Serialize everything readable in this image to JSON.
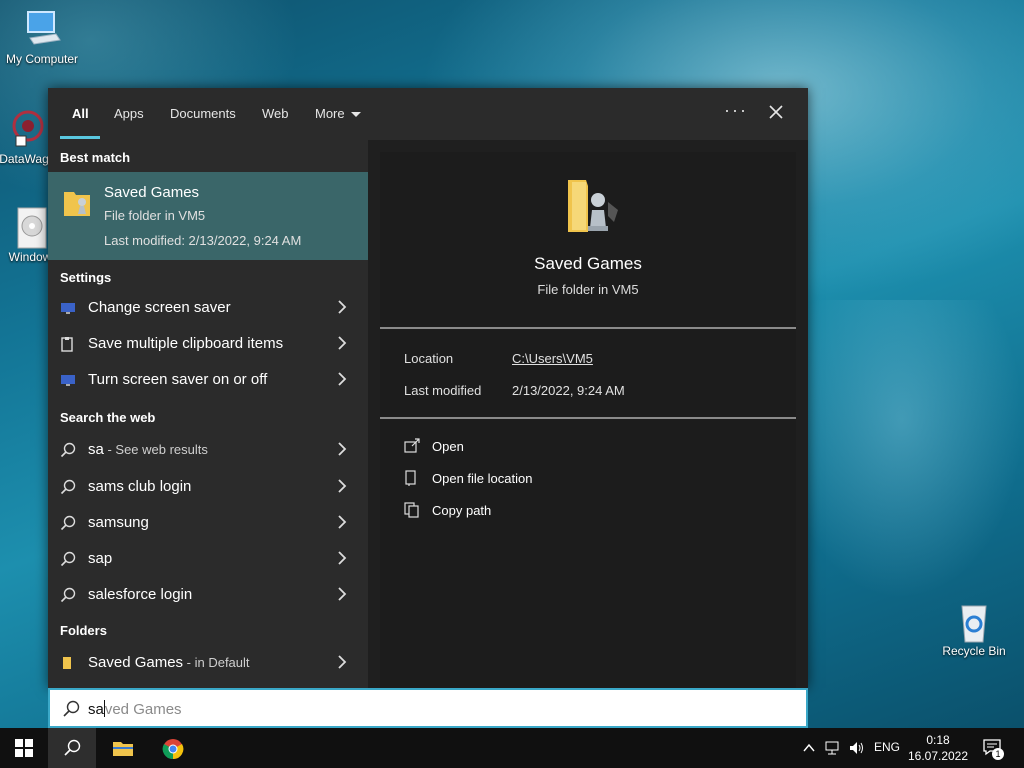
{
  "desktop": {
    "icons": [
      {
        "label": "My Computer"
      },
      {
        "label": "DataWag"
      },
      {
        "label": "Window"
      },
      {
        "label": "Recycle Bin"
      }
    ]
  },
  "tabs": [
    {
      "label": "All"
    },
    {
      "label": "Apps"
    },
    {
      "label": "Documents"
    },
    {
      "label": "Web"
    },
    {
      "label": "More"
    }
  ],
  "top_actions": {
    "more_options": "···"
  },
  "sections": {
    "best_match": "Best match",
    "settings": "Settings",
    "search_web": "Search the web",
    "folders": "Folders"
  },
  "best_match": {
    "title": "Saved Games",
    "type": "File folder in VM5",
    "modified": "Last modified: 2/13/2022, 9:24 AM"
  },
  "settings_items": [
    {
      "label": "Change screen saver"
    },
    {
      "label": "Save multiple clipboard items"
    },
    {
      "label": "Turn screen saver on or off"
    }
  ],
  "web_items": [
    {
      "label": "sa",
      "suffix": " - See web results"
    },
    {
      "label": "sams club login"
    },
    {
      "label": "samsung"
    },
    {
      "label": "sap"
    },
    {
      "label": "salesforce login"
    }
  ],
  "folder_items": [
    {
      "label": "Saved Games",
      "suffix": " - in Default"
    }
  ],
  "preview": {
    "name": "Saved Games",
    "kind": "File folder in VM5",
    "location_label": "Location",
    "location_value": "C:\\Users\\VM5",
    "modified_label": "Last modified",
    "modified_value": "2/13/2022, 9:24 AM",
    "actions": [
      {
        "label": "Open"
      },
      {
        "label": "Open file location"
      },
      {
        "label": "Copy path"
      }
    ]
  },
  "search": {
    "typed": "sa",
    "hint": "ved Games"
  },
  "taskbar": {
    "language": "ENG",
    "time": "0:18",
    "date": "16.07.2022",
    "notification_count": "1"
  },
  "colors": {
    "accent": "#5ac8e0",
    "selected_row": "#3a6669",
    "panel_bg": "#2b2b2b"
  }
}
